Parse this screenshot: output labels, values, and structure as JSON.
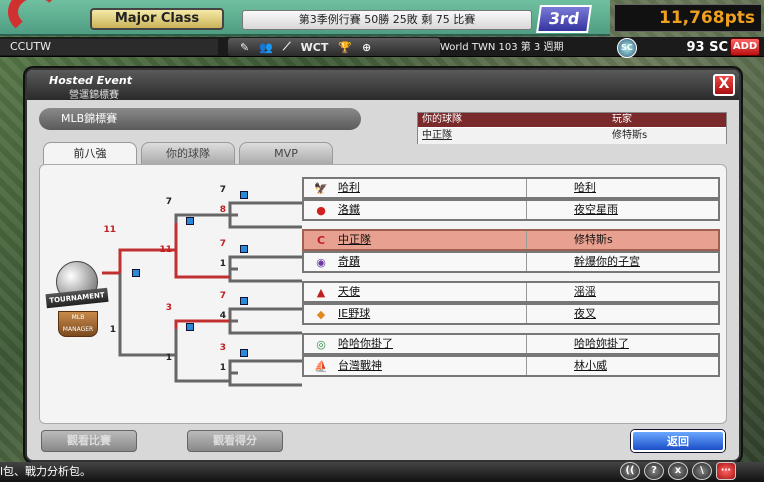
{
  "topbar": {
    "class_label": "Major Class",
    "season_status": "第3季例行賽 50勝 25敗 剩 75 比賽",
    "rank": "3rd",
    "points": "11,768pts",
    "username": "CCUTW",
    "menu": [
      "WCT"
    ],
    "world_info": "World TWN 103 第 3 週期",
    "sc_icon_label": "SC",
    "sc_value": "93 SC",
    "add_label": "ADD"
  },
  "dialog": {
    "title": "Hosted Event",
    "subtitle": "營運錦標賽",
    "event_name": "MLB錦標賽",
    "close_label": "X",
    "info_table": {
      "header_left": "你的球隊",
      "header_right": "玩家",
      "row_left": "中正隊",
      "row_right": "修特斯s"
    },
    "tabs": [
      {
        "label": "前八強",
        "active": true
      },
      {
        "label": "你的球隊",
        "active": false
      },
      {
        "label": "MVP",
        "active": false
      }
    ],
    "trophy": {
      "band_text": "TOURNAMENT",
      "base_text": "MLB MANAGER"
    },
    "scores": {
      "r1": [
        "7",
        "8",
        "7",
        "1",
        "7",
        "4",
        "3",
        "1"
      ],
      "r2": [
        "7",
        "11",
        "3",
        "1"
      ],
      "r3": [
        "11",
        "1"
      ]
    },
    "teams": [
      {
        "name": "哈利",
        "player": "哈利",
        "icon": "eagle",
        "highlight": false
      },
      {
        "name": "洛鐵",
        "player": "夜空星雨",
        "icon": "red-bird",
        "highlight": false
      },
      {
        "name": "中正隊",
        "player": "修特斯s",
        "icon": "c-logo",
        "highlight": true
      },
      {
        "name": "奇蹟",
        "player": "幹爆你的子宮",
        "icon": "purple-ball",
        "highlight": false
      },
      {
        "name": "天使",
        "player": "滛滛",
        "icon": "angel-a",
        "highlight": false
      },
      {
        "name": "IE野球",
        "player": "夜叉",
        "icon": "orange-bird",
        "highlight": false
      },
      {
        "name": "哈哈你掛了",
        "player": "哈哈妳掛了",
        "icon": "green-logo",
        "highlight": false
      },
      {
        "name": "台灣戰神",
        "player": "林小威",
        "icon": "ship",
        "highlight": false
      }
    ],
    "buttons": {
      "view_match": "觀看比賽",
      "view_score": "觀看得分",
      "back": "返回"
    }
  },
  "bottom": {
    "ticker": "l包、戰力分析包。",
    "icons": [
      "((",
      "?",
      "x",
      "\\",
      "chat"
    ]
  }
}
